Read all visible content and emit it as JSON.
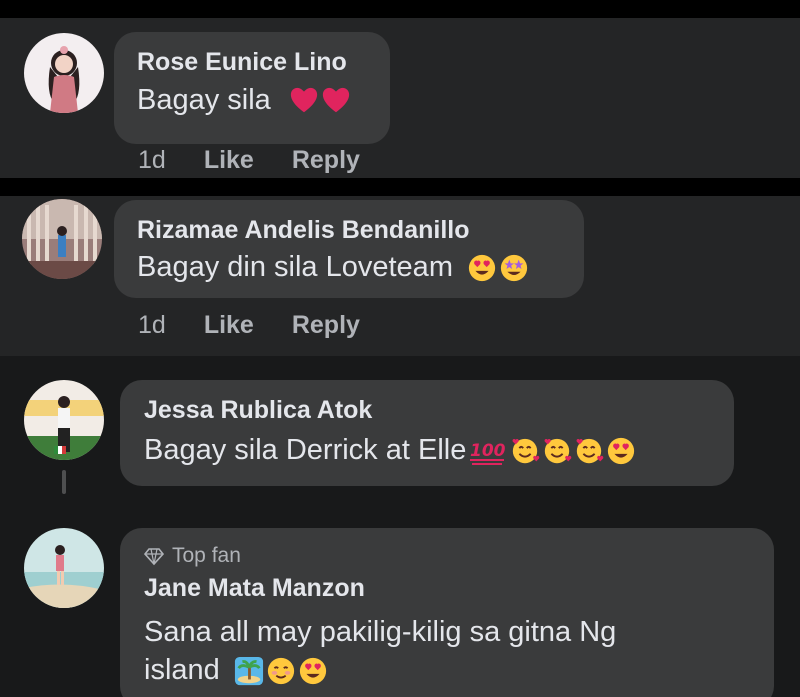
{
  "comments": [
    {
      "author": "Rose Eunice Lino",
      "text": "Bagay sila",
      "emojis": [
        "red-heart",
        "red-heart"
      ],
      "time": "1d",
      "like_label": "Like",
      "reply_label": "Reply"
    },
    {
      "author": "Rizamae Andelis Bendanillo",
      "text": "Bagay din sila Loveteam",
      "emojis": [
        "heart-eyes",
        "star-struck"
      ],
      "time": "1d",
      "like_label": "Like",
      "reply_label": "Reply"
    },
    {
      "author": "Jessa Rublica Atok",
      "text": "Bagay sila Derrick at Elle",
      "emojis": [
        "hundred-points",
        "smiling-face-with-hearts",
        "smiling-face-with-hearts",
        "smiling-face-with-hearts",
        "heart-eyes"
      ]
    },
    {
      "badge": "Top fan",
      "badge_icon": "diamond-icon",
      "author": "Jane Mata Manzon",
      "text_line1": "Sana all may pakilig-kilig sa gitna Ng",
      "text_line2": "island",
      "emojis": [
        "desert-island",
        "smiling-face",
        "heart-eyes"
      ]
    }
  ],
  "colors": {
    "panel": "#242526",
    "bubble": "#3a3b3c",
    "text_primary": "#e4e6eb",
    "text_secondary": "#b0b3b8",
    "heart": "#e0245e",
    "emoji_yellow": "#ffc83d"
  }
}
